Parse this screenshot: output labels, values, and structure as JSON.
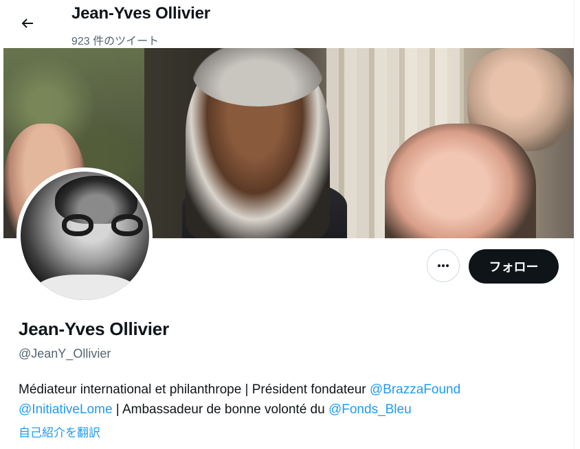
{
  "header": {
    "title": "Jean-Yves Ollivier",
    "tweet_count": "923 件のツイート",
    "back_icon": "arrow-left-icon"
  },
  "profile": {
    "display_name": "Jean-Yves Ollivier",
    "handle": "@JeanY_Ollivier",
    "more_icon": "more-horizontal-icon",
    "follow_label": "フォロー",
    "bio": {
      "line1_text": "Médiateur international et philanthrope | Président fondateur ",
      "mention1": "@BrazzaFound",
      "mention2": "@InitiativeLome",
      "line2_text": " | Ambassadeur de bonne volonté du ",
      "mention3": "@Fonds_Bleu"
    },
    "translate_label": "自己紹介を翻訳"
  },
  "colors": {
    "accent": "#1d9bf0",
    "text": "#0f1419",
    "secondary": "#536471",
    "button_dark": "#0f1419",
    "border": "#cfd9de"
  }
}
